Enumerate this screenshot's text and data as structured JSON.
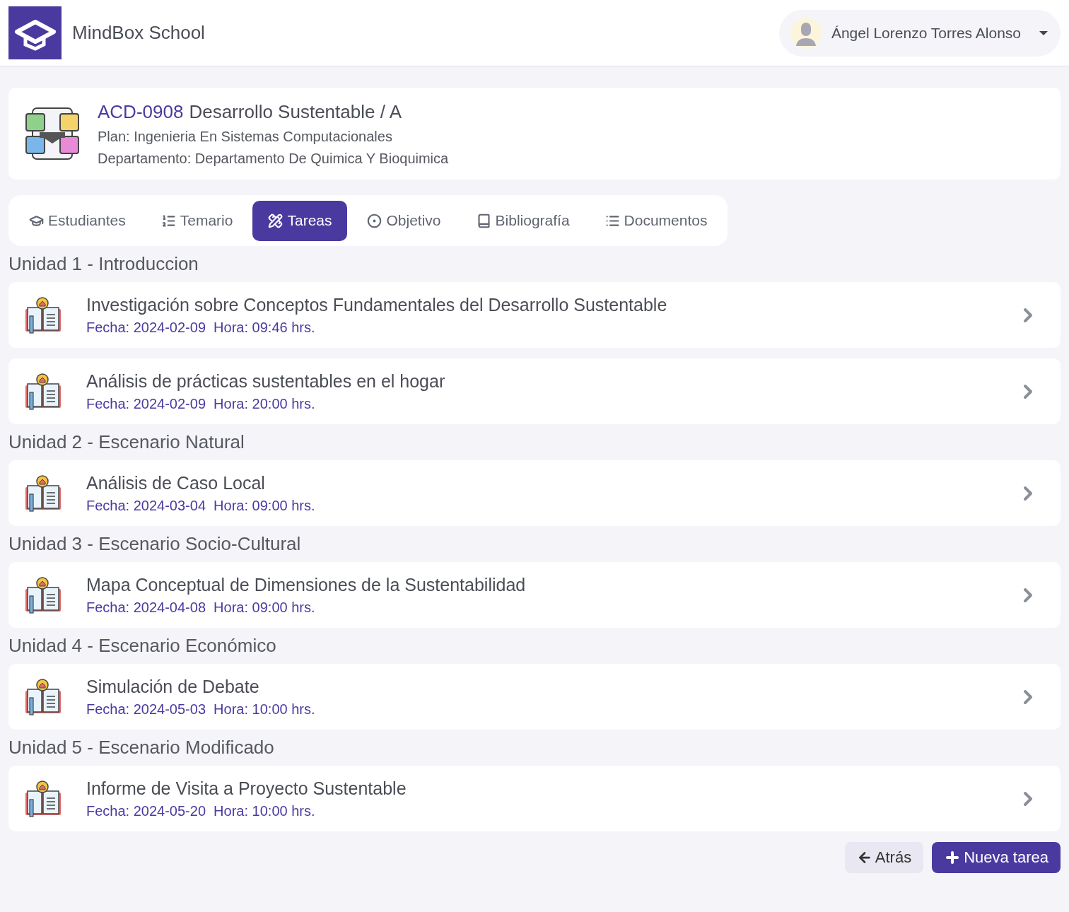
{
  "header": {
    "brand": "MindBox School",
    "user": {
      "name": "Ángel Lorenzo Torres Alonso"
    }
  },
  "course": {
    "code": "ACD-0908",
    "name": "Desarrollo Sustentable / A",
    "plan": "Plan: Ingenieria En Sistemas Computacionales",
    "department": "Departamento: Departamento De Quimica Y Bioquimica"
  },
  "tabs": [
    {
      "label": "Estudiantes",
      "selected": false
    },
    {
      "label": "Temario",
      "selected": false
    },
    {
      "label": "Tareas",
      "selected": true
    },
    {
      "label": "Objetivo",
      "selected": false
    },
    {
      "label": "Bibliografía",
      "selected": false
    },
    {
      "label": "Documentos",
      "selected": false
    }
  ],
  "units": [
    {
      "title": "Unidad 1 - Introduccion",
      "tasks": [
        {
          "title": "Investigación sobre Conceptos Fundamentales del Desarrollo Sustentable",
          "meta": "Fecha: 2024-02-09  Hora: 09:46 hrs."
        },
        {
          "title": "Análisis de prácticas sustentables en el hogar",
          "meta": "Fecha: 2024-02-09  Hora: 20:00 hrs."
        }
      ]
    },
    {
      "title": "Unidad 2 - Escenario Natural",
      "tasks": [
        {
          "title": "Análisis de Caso Local",
          "meta": "Fecha: 2024-03-04  Hora: 09:00 hrs."
        }
      ]
    },
    {
      "title": "Unidad 3 - Escenario Socio-Cultural",
      "tasks": [
        {
          "title": "Mapa Conceptual de Dimensiones de la Sustentabilidad",
          "meta": "Fecha: 2024-04-08  Hora: 09:00 hrs."
        }
      ]
    },
    {
      "title": "Unidad 4 - Escenario Económico",
      "tasks": [
        {
          "title": "Simulación de Debate",
          "meta": "Fecha: 2024-05-03  Hora: 10:00 hrs."
        }
      ]
    },
    {
      "title": "Unidad 5 - Escenario Modificado",
      "tasks": [
        {
          "title": "Informe de Visita a Proyecto Sustentable",
          "meta": "Fecha: 2024-05-20  Hora: 10:00 hrs."
        }
      ]
    }
  ],
  "actions": {
    "back": "Atrás",
    "create": "Nueva tarea"
  }
}
